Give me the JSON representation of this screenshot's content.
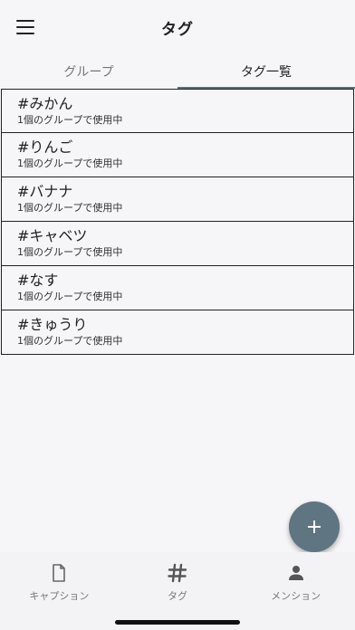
{
  "header": {
    "title": "タグ"
  },
  "tabs": [
    {
      "label": "グループ"
    },
    {
      "label": "タグ一覧"
    }
  ],
  "tags": [
    {
      "name": "#みかん",
      "sub": "1個のグループで使用中"
    },
    {
      "name": "#りんご",
      "sub": "1個のグループで使用中"
    },
    {
      "name": "#バナナ",
      "sub": "1個のグループで使用中"
    },
    {
      "name": "#キャベツ",
      "sub": "1個のグループで使用中"
    },
    {
      "name": "#なす",
      "sub": "1個のグループで使用中"
    },
    {
      "name": "#きゅうり",
      "sub": "1個のグループで使用中"
    }
  ],
  "fab": {
    "icon": "plus-icon"
  },
  "bottom_nav": [
    {
      "label": "キャプション",
      "icon": "document-icon"
    },
    {
      "label": "タグ",
      "icon": "hash-icon"
    },
    {
      "label": "メンション",
      "icon": "person-icon"
    }
  ],
  "colors": {
    "accent": "#5f7581",
    "tab_indicator": "#5a6f7c",
    "border": "#222222"
  }
}
